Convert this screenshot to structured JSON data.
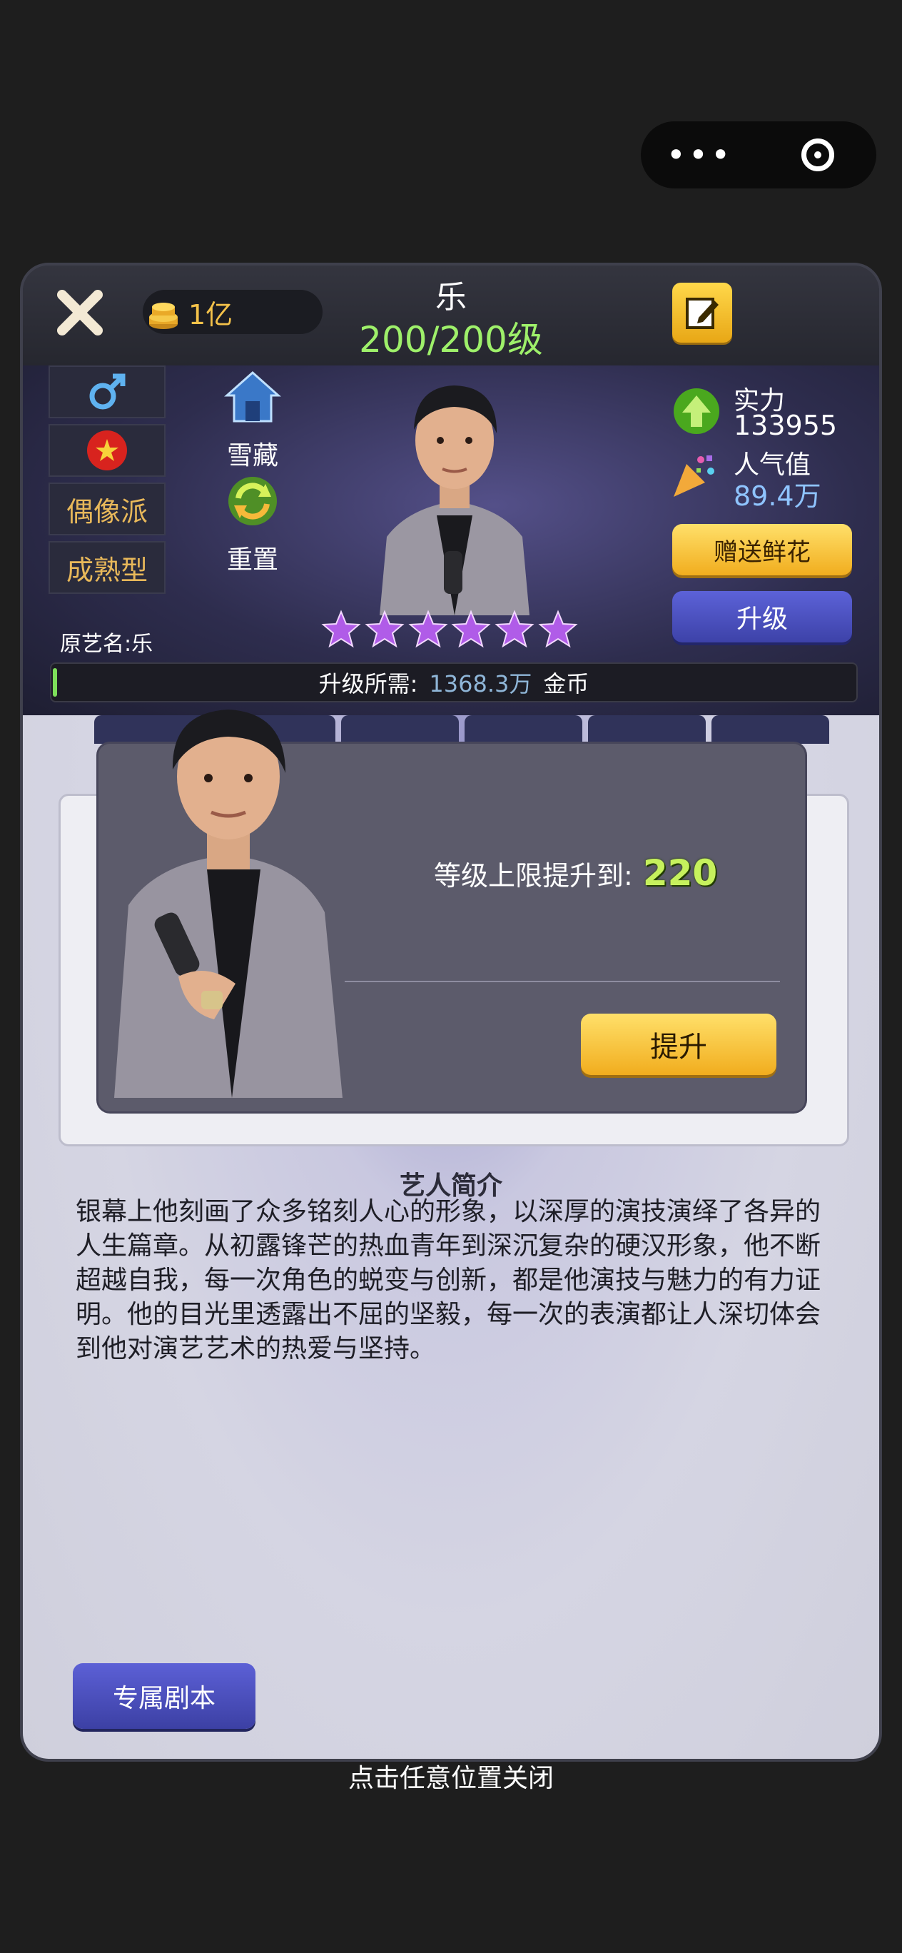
{
  "capsule": {
    "more_label": "•••",
    "close_icon": "target-circle-icon"
  },
  "header": {
    "coins": "1亿",
    "name": "乐",
    "level": "200/200级"
  },
  "profile": {
    "gender_icon": "male-icon",
    "badge_icon": "flag-icon",
    "tags": [
      "偶像派",
      "成熟型"
    ],
    "original_name": "原艺名:乐",
    "stash_label": "雪藏",
    "reset_label": "重置",
    "stars": 6
  },
  "stats": {
    "power_label": "实力",
    "power_value": "133955",
    "popularity_label": "人气值",
    "popularity_value": "89.4万",
    "gift_label": "赠送鲜花",
    "upgrade_label": "升级"
  },
  "progress": {
    "label": "升级所需:",
    "amount": "1368.3万",
    "unit": "金币",
    "fill_fraction": 0.005
  },
  "modal": {
    "text": "等级上限提升到:",
    "value": "220",
    "button": "提升"
  },
  "intro": {
    "title": "艺人简介",
    "text": "银幕上他刻画了众多铭刻人心的形象，以深厚的演技演绎了各异的人生篇章。从初露锋芒的热血青年到深沉复杂的硬汉形象，他不断超越自我，每一次角色的蜕变与创新，都是他演技与魅力的有力证明。他的目光里透露出不屈的坚毅，每一次的表演都让人深切体会到他对演艺艺术的热爱与坚持。"
  },
  "script_button": "专属剧本",
  "close_tip": "点击任意位置关闭",
  "colors": {
    "level_green": "#9ef06a",
    "coin_gold": "#f4c24a",
    "gold_button": "#f1ad1e",
    "blue_button": "#3d42a8",
    "star_purple": "#b05ce8",
    "modal_value": "#c6f15d"
  }
}
